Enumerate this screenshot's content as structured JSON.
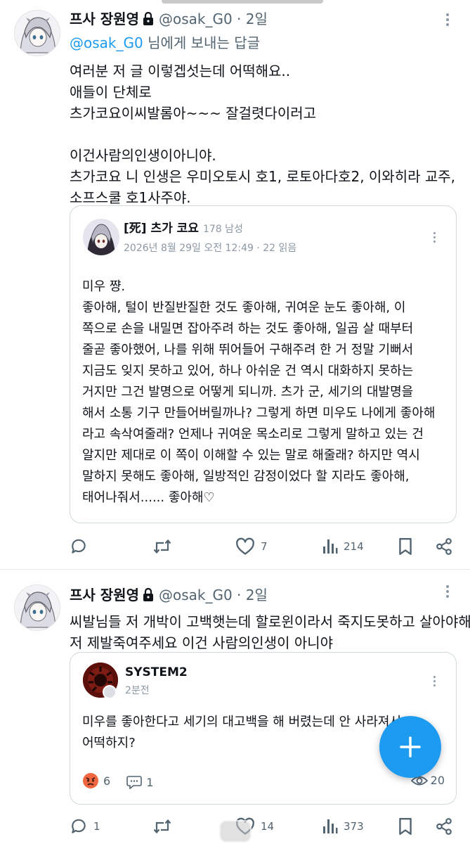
{
  "colors": {
    "accent": "#1d9bf0",
    "text_primary": "#0f1419",
    "text_secondary": "#536471",
    "border": "#cfd9de"
  },
  "tweets": [
    {
      "author_name": "프사 장원영",
      "handle": "@osak_G0",
      "separator": "·",
      "time": "2일",
      "protected_icon": "lock-icon",
      "reply_mention": "@osak_G0",
      "reply_suffix": " 님에게 보내는 답글",
      "lines": [
        "여러분 저 글 이렇겝섯는데 어떡해요..",
        "애들이 단체로",
        "츠가코요이씨발롬아~~~ 잘걸렷다이러고",
        "",
        "이건사람의인생이아니야.",
        "츠가코요 니 인생은 우미오토시 호1, 로토아다호2, 이와히라 교주,",
        "소프스쿨 호1사주야."
      ],
      "quote": {
        "name": "[死] 츠가 코요",
        "sub": "178 남성",
        "meta": "2026년 8월 29일 오전 12:49 · 22 읽음",
        "lines": [
          "미우 쨩.",
          "좋아해, 털이 반질반질한 것도 좋아해, 귀여운 눈도 좋아해, 이",
          "쪽으로 손을 내밀면 잡아주려 하는 것도 좋아해, 일곱 살 때부터",
          "줄곧 좋아했어, 나를 위해 뛰어들어 구해주려 한 거 정말 기뻐서",
          "지금도 잊지 못하고 있어, 하나 아쉬운 건 역시 대화하지 못하는",
          "거지만 그건 발명으로 어떻게 되니까. 츠가 군, 세기의 대발명을",
          "해서 소통 기구 만들어버릴까나? 그렇게 하면 미우도 나에게 좋아해",
          "라고 속삭여줄래? 언제나 귀여운 목소리로 그렇게 말하고 있는 건",
          "알지만 제대로 이 쪽이 이해할 수 있는 말로 해줄래? 하지만 역시",
          "말하지 못해도 좋아해, 일방적인 감정이었다 할 지라도 좋아해,",
          "태어나줘서...... 좋아해♡"
        ]
      },
      "actions": {
        "reply": "",
        "retweet": "",
        "like": "7",
        "views": "214"
      }
    },
    {
      "author_name": "프사 장원영",
      "handle": "@osak_G0",
      "separator": "·",
      "time": "2일",
      "protected_icon": "lock-icon",
      "lines": [
        "씨발님들 저 개박이 고백햇는데 할로윈이라서 죽지도못하고 살아야해요",
        "저 제발죽여주세요 이건 사람의인생이 아니야"
      ],
      "quote": {
        "name": "SYSTEM2",
        "meta": "2분전",
        "lines": [
          "미우를 좋아한다고 세기의 대고백을 해 버렸는데 안 사라져서",
          "어떡하지?"
        ],
        "reaction_angry": "6",
        "reaction_comment": "1",
        "views": "20"
      },
      "actions": {
        "reply": "1",
        "retweet": "",
        "like": "14",
        "views": "373"
      }
    }
  ]
}
